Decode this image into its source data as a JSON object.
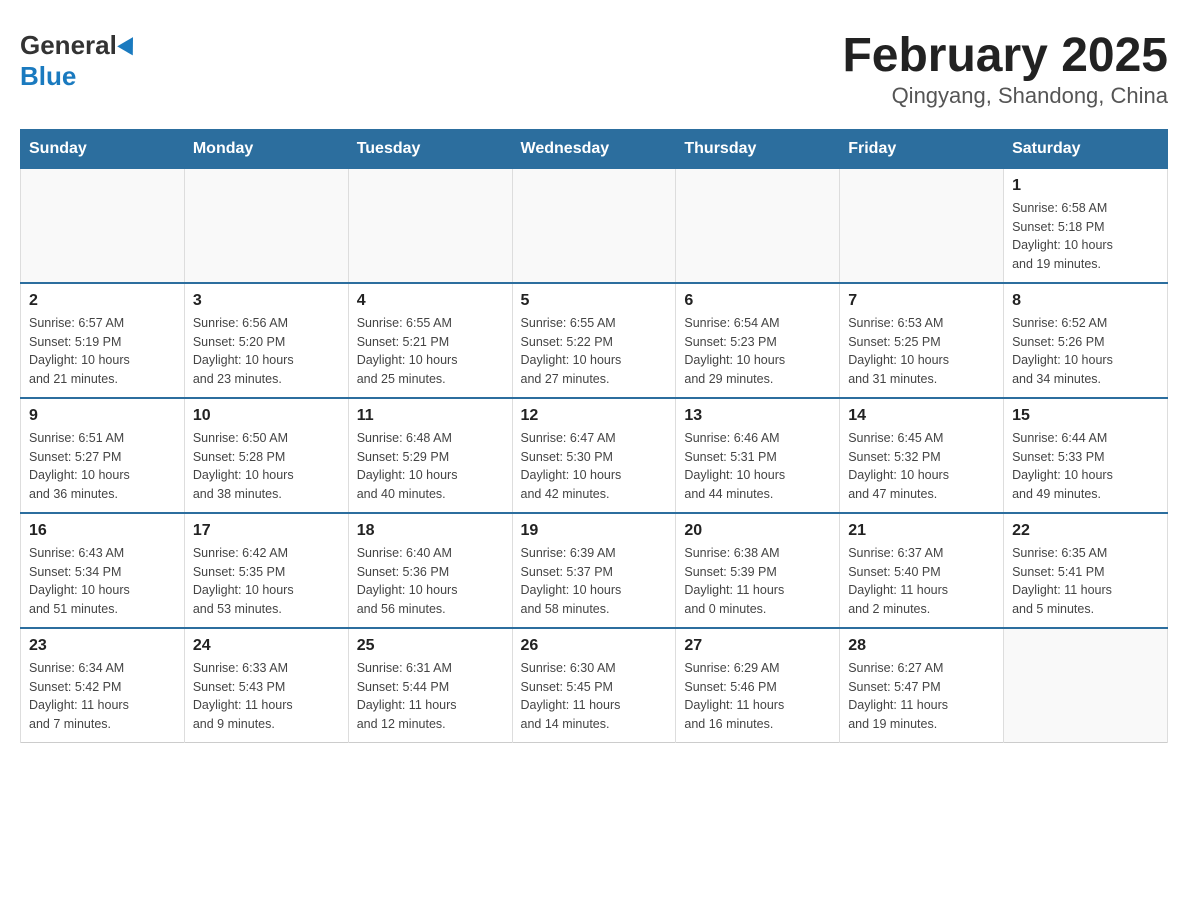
{
  "header": {
    "logo_general": "General",
    "logo_blue": "Blue",
    "title": "February 2025",
    "subtitle": "Qingyang, Shandong, China"
  },
  "weekdays": [
    "Sunday",
    "Monday",
    "Tuesday",
    "Wednesday",
    "Thursday",
    "Friday",
    "Saturday"
  ],
  "weeks": [
    [
      {
        "day": "",
        "info": ""
      },
      {
        "day": "",
        "info": ""
      },
      {
        "day": "",
        "info": ""
      },
      {
        "day": "",
        "info": ""
      },
      {
        "day": "",
        "info": ""
      },
      {
        "day": "",
        "info": ""
      },
      {
        "day": "1",
        "info": "Sunrise: 6:58 AM\nSunset: 5:18 PM\nDaylight: 10 hours\nand 19 minutes."
      }
    ],
    [
      {
        "day": "2",
        "info": "Sunrise: 6:57 AM\nSunset: 5:19 PM\nDaylight: 10 hours\nand 21 minutes."
      },
      {
        "day": "3",
        "info": "Sunrise: 6:56 AM\nSunset: 5:20 PM\nDaylight: 10 hours\nand 23 minutes."
      },
      {
        "day": "4",
        "info": "Sunrise: 6:55 AM\nSunset: 5:21 PM\nDaylight: 10 hours\nand 25 minutes."
      },
      {
        "day": "5",
        "info": "Sunrise: 6:55 AM\nSunset: 5:22 PM\nDaylight: 10 hours\nand 27 minutes."
      },
      {
        "day": "6",
        "info": "Sunrise: 6:54 AM\nSunset: 5:23 PM\nDaylight: 10 hours\nand 29 minutes."
      },
      {
        "day": "7",
        "info": "Sunrise: 6:53 AM\nSunset: 5:25 PM\nDaylight: 10 hours\nand 31 minutes."
      },
      {
        "day": "8",
        "info": "Sunrise: 6:52 AM\nSunset: 5:26 PM\nDaylight: 10 hours\nand 34 minutes."
      }
    ],
    [
      {
        "day": "9",
        "info": "Sunrise: 6:51 AM\nSunset: 5:27 PM\nDaylight: 10 hours\nand 36 minutes."
      },
      {
        "day": "10",
        "info": "Sunrise: 6:50 AM\nSunset: 5:28 PM\nDaylight: 10 hours\nand 38 minutes."
      },
      {
        "day": "11",
        "info": "Sunrise: 6:48 AM\nSunset: 5:29 PM\nDaylight: 10 hours\nand 40 minutes."
      },
      {
        "day": "12",
        "info": "Sunrise: 6:47 AM\nSunset: 5:30 PM\nDaylight: 10 hours\nand 42 minutes."
      },
      {
        "day": "13",
        "info": "Sunrise: 6:46 AM\nSunset: 5:31 PM\nDaylight: 10 hours\nand 44 minutes."
      },
      {
        "day": "14",
        "info": "Sunrise: 6:45 AM\nSunset: 5:32 PM\nDaylight: 10 hours\nand 47 minutes."
      },
      {
        "day": "15",
        "info": "Sunrise: 6:44 AM\nSunset: 5:33 PM\nDaylight: 10 hours\nand 49 minutes."
      }
    ],
    [
      {
        "day": "16",
        "info": "Sunrise: 6:43 AM\nSunset: 5:34 PM\nDaylight: 10 hours\nand 51 minutes."
      },
      {
        "day": "17",
        "info": "Sunrise: 6:42 AM\nSunset: 5:35 PM\nDaylight: 10 hours\nand 53 minutes."
      },
      {
        "day": "18",
        "info": "Sunrise: 6:40 AM\nSunset: 5:36 PM\nDaylight: 10 hours\nand 56 minutes."
      },
      {
        "day": "19",
        "info": "Sunrise: 6:39 AM\nSunset: 5:37 PM\nDaylight: 10 hours\nand 58 minutes."
      },
      {
        "day": "20",
        "info": "Sunrise: 6:38 AM\nSunset: 5:39 PM\nDaylight: 11 hours\nand 0 minutes."
      },
      {
        "day": "21",
        "info": "Sunrise: 6:37 AM\nSunset: 5:40 PM\nDaylight: 11 hours\nand 2 minutes."
      },
      {
        "day": "22",
        "info": "Sunrise: 6:35 AM\nSunset: 5:41 PM\nDaylight: 11 hours\nand 5 minutes."
      }
    ],
    [
      {
        "day": "23",
        "info": "Sunrise: 6:34 AM\nSunset: 5:42 PM\nDaylight: 11 hours\nand 7 minutes."
      },
      {
        "day": "24",
        "info": "Sunrise: 6:33 AM\nSunset: 5:43 PM\nDaylight: 11 hours\nand 9 minutes."
      },
      {
        "day": "25",
        "info": "Sunrise: 6:31 AM\nSunset: 5:44 PM\nDaylight: 11 hours\nand 12 minutes."
      },
      {
        "day": "26",
        "info": "Sunrise: 6:30 AM\nSunset: 5:45 PM\nDaylight: 11 hours\nand 14 minutes."
      },
      {
        "day": "27",
        "info": "Sunrise: 6:29 AM\nSunset: 5:46 PM\nDaylight: 11 hours\nand 16 minutes."
      },
      {
        "day": "28",
        "info": "Sunrise: 6:27 AM\nSunset: 5:47 PM\nDaylight: 11 hours\nand 19 minutes."
      },
      {
        "day": "",
        "info": ""
      }
    ]
  ]
}
